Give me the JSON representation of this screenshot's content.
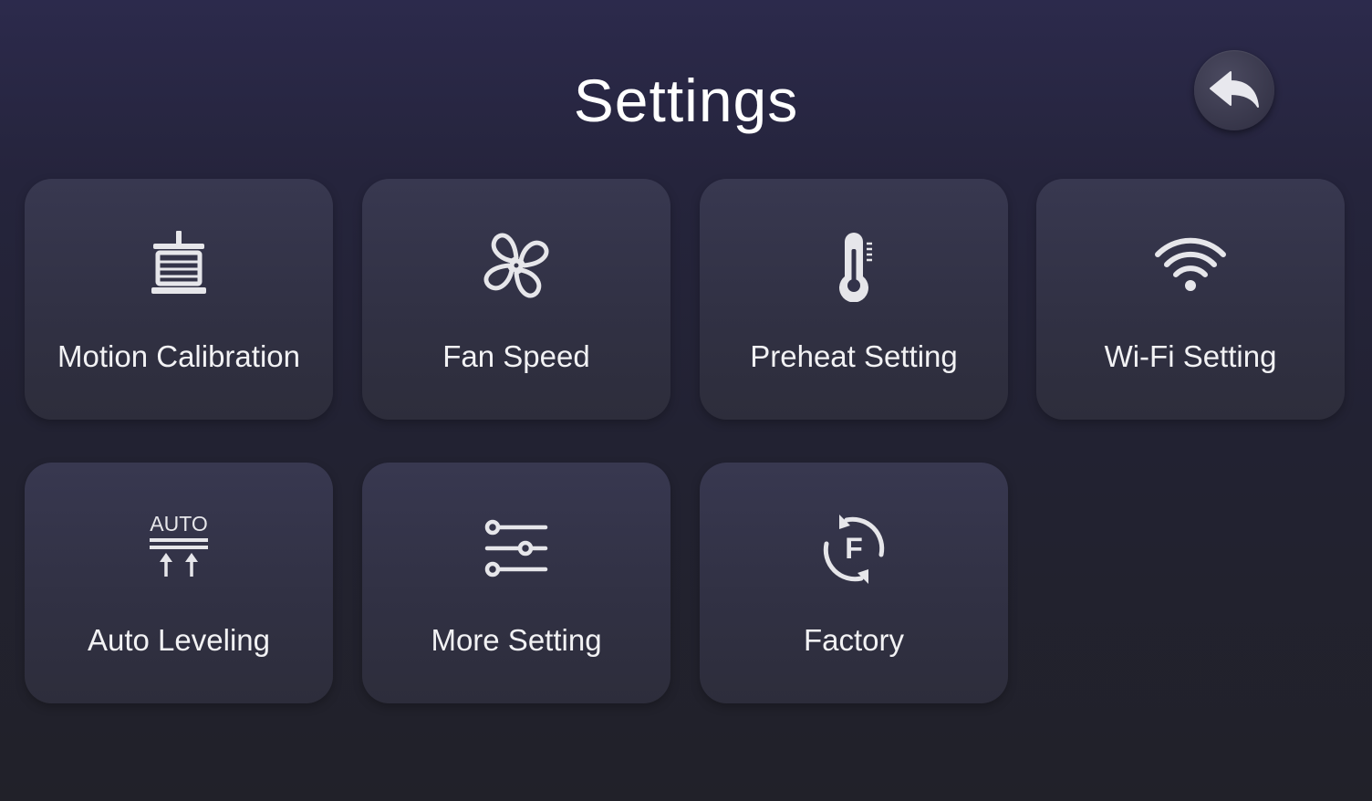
{
  "header": {
    "title": "Settings",
    "back_icon": "back-arrow-icon"
  },
  "tiles": [
    {
      "label": "Motion Calibration",
      "icon": "motion-calibration-icon"
    },
    {
      "label": "Fan Speed",
      "icon": "fan-icon"
    },
    {
      "label": "Preheat Setting",
      "icon": "thermometer-icon"
    },
    {
      "label": "Wi-Fi Setting",
      "icon": "wifi-icon"
    },
    {
      "label": "Auto Leveling",
      "icon": "auto-leveling-icon",
      "icon_text": "AUTO"
    },
    {
      "label": "More Setting",
      "icon": "sliders-icon"
    },
    {
      "label": "Factory",
      "icon": "factory-reset-icon",
      "icon_text": "F"
    }
  ],
  "colors": {
    "background": "#25243c",
    "tile": "#333346",
    "text": "#f2f2f4",
    "icon": "#e6e6ea"
  }
}
